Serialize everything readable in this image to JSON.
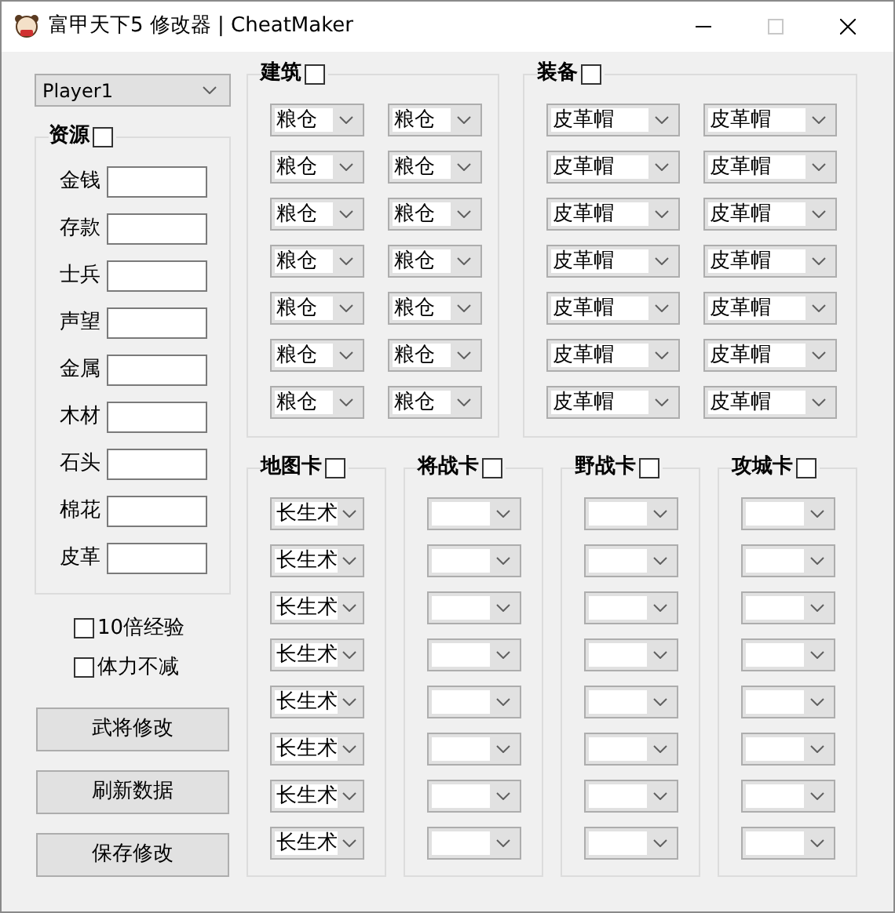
{
  "window": {
    "title": "富甲天下5 修改器 | CheatMaker"
  },
  "player_select": {
    "value": "Player1"
  },
  "resources": {
    "title": "资源",
    "checked": false,
    "fields": [
      "金钱",
      "存款",
      "士兵",
      "声望",
      "金属",
      "木材",
      "石头",
      "棉花",
      "皮革"
    ]
  },
  "options": [
    {
      "label": "10倍经验",
      "checked": false
    },
    {
      "label": "体力不减",
      "checked": false
    }
  ],
  "buttons": [
    "武将修改",
    "刷新数据",
    "保存修改"
  ],
  "top_groups": [
    {
      "title": "建筑",
      "checked": false,
      "rows": [
        [
          "粮仓",
          "粮仓"
        ],
        [
          "粮仓",
          "粮仓"
        ],
        [
          "粮仓",
          "粮仓"
        ],
        [
          "粮仓",
          "粮仓"
        ],
        [
          "粮仓",
          "粮仓"
        ],
        [
          "粮仓",
          "粮仓"
        ],
        [
          "粮仓",
          "粮仓"
        ]
      ]
    },
    {
      "title": "装备",
      "checked": false,
      "rows": [
        [
          "皮革帽",
          "皮革帽"
        ],
        [
          "皮革帽",
          "皮革帽"
        ],
        [
          "皮革帽",
          "皮革帽"
        ],
        [
          "皮革帽",
          "皮革帽"
        ],
        [
          "皮革帽",
          "皮革帽"
        ],
        [
          "皮革帽",
          "皮革帽"
        ],
        [
          "皮革帽",
          "皮革帽"
        ]
      ]
    }
  ],
  "card_groups": [
    {
      "title": "地图卡",
      "checked": false,
      "combos": [
        {
          "kind": "filled",
          "value": "长生术"
        },
        {
          "kind": "filled",
          "value": "长生术"
        },
        {
          "kind": "filled",
          "value": "长生术"
        },
        {
          "kind": "filled",
          "value": "长生术"
        },
        {
          "kind": "filled",
          "value": "长生术"
        },
        {
          "kind": "filled",
          "value": "长生术"
        },
        {
          "kind": "filled",
          "value": "长生术"
        },
        {
          "kind": "filled",
          "value": "长生术"
        }
      ]
    },
    {
      "title": "将战卡",
      "checked": false,
      "combos": [
        {
          "kind": "blank"
        },
        {
          "kind": "blank"
        },
        {
          "kind": "blank"
        },
        {
          "kind": "blank"
        },
        {
          "kind": "blank"
        },
        {
          "kind": "blank"
        },
        {
          "kind": "blank"
        },
        {
          "kind": "blank"
        }
      ]
    },
    {
      "title": "野战卡",
      "checked": false,
      "combos": [
        {
          "kind": "blank"
        },
        {
          "kind": "blank"
        },
        {
          "kind": "blank"
        },
        {
          "kind": "blank"
        },
        {
          "kind": "blank"
        },
        {
          "kind": "blank"
        },
        {
          "kind": "blank"
        },
        {
          "kind": "blank"
        }
      ]
    },
    {
      "title": "攻城卡",
      "checked": false,
      "combos": [
        {
          "kind": "blank"
        },
        {
          "kind": "blank"
        },
        {
          "kind": "blank"
        },
        {
          "kind": "blank"
        },
        {
          "kind": "blank"
        },
        {
          "kind": "blank"
        },
        {
          "kind": "blank"
        },
        {
          "kind": "blank"
        }
      ]
    }
  ]
}
